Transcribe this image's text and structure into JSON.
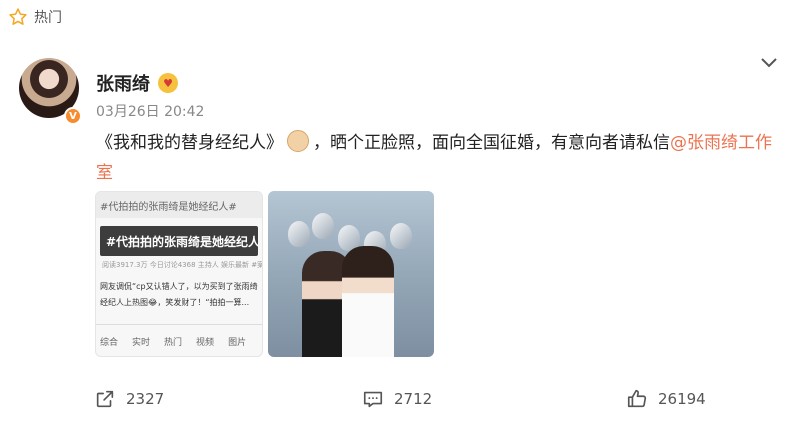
{
  "header": {
    "hot_label": "热门"
  },
  "post": {
    "author": "张雨绮",
    "verified_badge": "V",
    "timestamp": "03月26日  20:42",
    "text_part1": "《我和我的替身经纪人》",
    "text_part2": "，晒个正脸照，面向全国征婚，有意向者请私信",
    "mention": "@张雨绮工作室"
  },
  "images": {
    "screenshot": {
      "header": "#代拍拍的张雨绮是她经纪人#",
      "banner": "#代拍拍的张雨绮是她经纪人#",
      "meta": "阅读3917.3万   今日讨论4368   主持人  娱乐最新   #案媒体发布",
      "line1": "网友调侃“cp又认错人了，以为买到了张雨绮",
      "line2": "经纪人上热图😂，笑发财了！“拍拍一算...",
      "tabs": [
        "综合",
        "实时",
        "热门",
        "视频",
        "图片"
      ]
    }
  },
  "actions": {
    "share_count": "2327",
    "comment_count": "2712",
    "like_count": "26194"
  },
  "colors": {
    "accent": "#eb7350",
    "badge": "#f78b2e",
    "star": "#f5a623"
  }
}
